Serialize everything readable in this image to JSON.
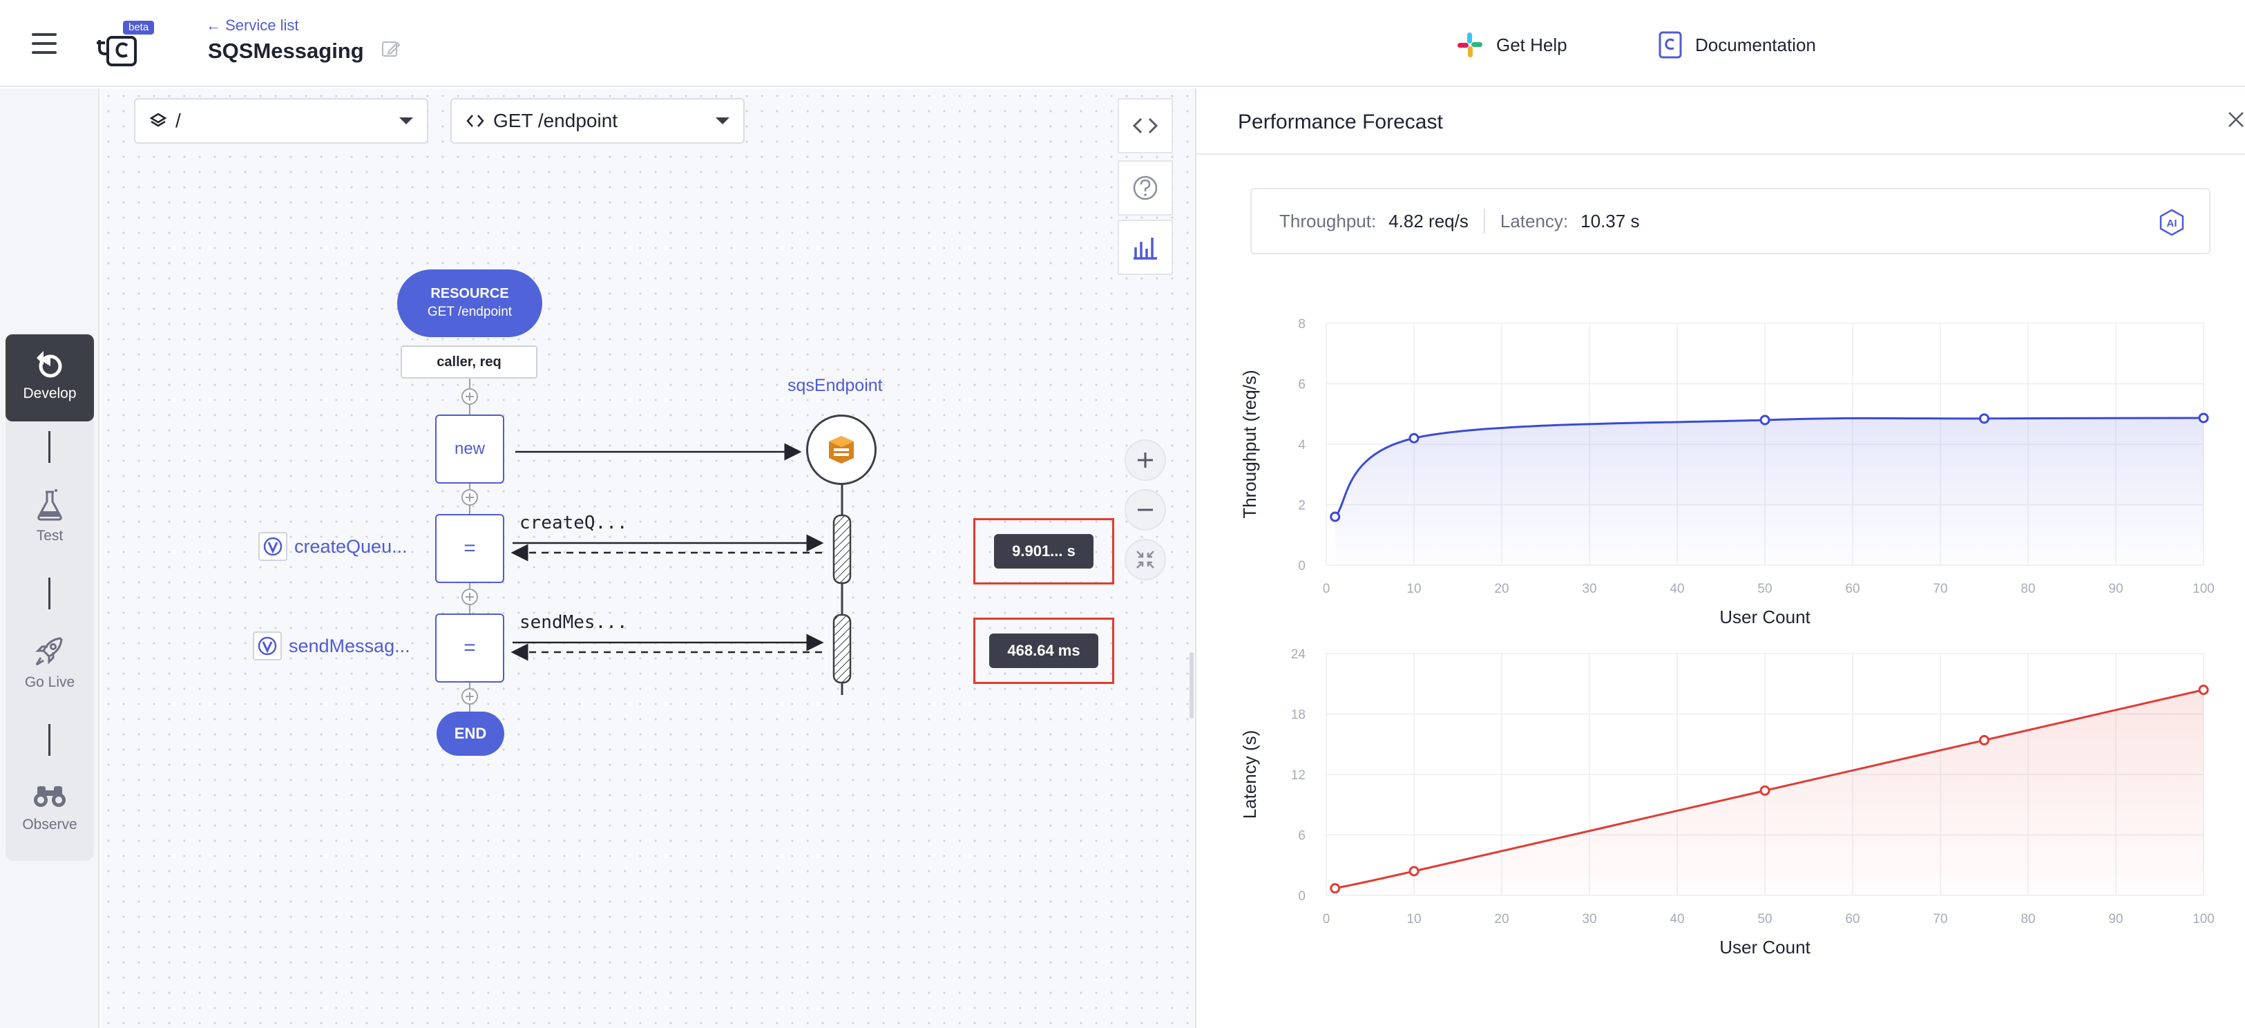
{
  "header": {
    "beta_badge": "beta",
    "back_link": "← Service list",
    "service_name": "SQSMessaging",
    "help_label": "Get Help",
    "docs_label": "Documentation"
  },
  "sidebar": {
    "items": [
      {
        "label": "Develop",
        "icon": "develop-icon",
        "active": true
      },
      {
        "label": "Test",
        "icon": "flask-icon",
        "active": false
      },
      {
        "label": "Go Live",
        "icon": "rocket-icon",
        "active": false
      },
      {
        "label": "Observe",
        "icon": "binoculars-icon",
        "active": false
      }
    ]
  },
  "canvas": {
    "module_select": "/",
    "resource_select": "GET /endpoint",
    "resource_node": {
      "title": "RESOURCE",
      "subtitle": "GET /endpoint"
    },
    "params": "caller, req",
    "new_node": "new",
    "assign_symbol": "=",
    "end_node": "END",
    "endpoint_name": "sqsEndpoint",
    "calls": [
      {
        "function": "createQueu...",
        "action": "createQ...",
        "time": "9.901... s"
      },
      {
        "function": "sendMessag...",
        "action": "sendMes...",
        "time": "468.64 ms"
      }
    ]
  },
  "panel": {
    "title": "Performance Forecast",
    "throughput_label": "Throughput:",
    "throughput_value": "4.82 req/s",
    "latency_label": "Latency:",
    "latency_value": "10.37 s",
    "ai_badge": "AI"
  },
  "chart_data": [
    {
      "type": "area",
      "ylabel": "Throughput (req/s)",
      "xlabel": "User Count",
      "xlim": [
        0,
        100
      ],
      "ylim": [
        0,
        8
      ],
      "x_ticks": [
        0,
        10,
        20,
        30,
        40,
        50,
        60,
        70,
        80,
        90,
        100
      ],
      "y_ticks": [
        0,
        2,
        4,
        6,
        8
      ],
      "x": [
        1,
        10,
        50,
        75,
        100
      ],
      "values": [
        1.6,
        4.2,
        4.8,
        4.85,
        4.87
      ],
      "color": "#3b4ad6",
      "grid": true
    },
    {
      "type": "area",
      "ylabel": "Latency (s)",
      "xlabel": "User Count",
      "xlim": [
        0,
        100
      ],
      "ylim": [
        0,
        24
      ],
      "x_ticks": [
        0,
        10,
        20,
        30,
        40,
        50,
        60,
        70,
        80,
        90,
        100
      ],
      "y_ticks": [
        0,
        6,
        12,
        18,
        24
      ],
      "x": [
        1,
        10,
        50,
        75,
        100
      ],
      "values": [
        0.7,
        2.4,
        10.4,
        15.4,
        20.4
      ],
      "color": "#e03b34",
      "grid": true
    }
  ]
}
